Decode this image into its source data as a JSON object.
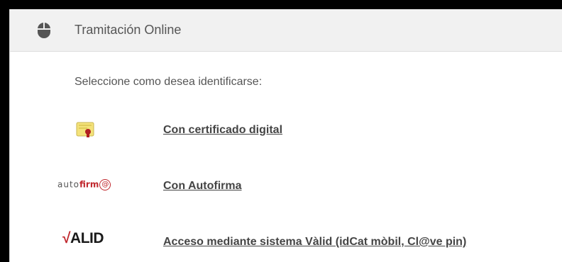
{
  "panel": {
    "title": "Tramitación Online",
    "icon": "mouse-icon"
  },
  "main": {
    "prompt": "Seleccione como desea identificarse:",
    "options": [
      {
        "label": "Con certificado digital",
        "icon": "certificate-icon"
      },
      {
        "label": "Con Autofirma",
        "icon": "autofirma-logo",
        "logo_text_light": "auto",
        "logo_text_strong": "firm",
        "logo_ring": "@"
      },
      {
        "label": "Acceso mediante sistema Vàlid (idCat mòbil, Cl@ve pin)",
        "icon": "valid-logo",
        "logo_mark": "√",
        "logo_text": "ALID"
      }
    ]
  },
  "colors": {
    "header_bg": "#f1f1f1",
    "text": "#555555",
    "link": "#444444",
    "brand_red": "#c0272d"
  }
}
